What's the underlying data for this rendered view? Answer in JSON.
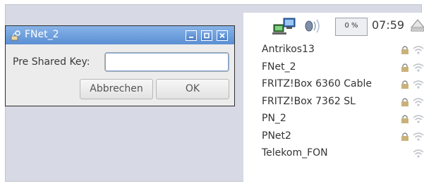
{
  "dialog": {
    "title": "FNet_2",
    "title_icon": "wifi-key-icon",
    "window_buttons": {
      "minimize": "minimize-icon",
      "maximize": "maximize-icon",
      "close": "close-icon"
    },
    "psk_label": "Pre Shared Key:",
    "psk_value": "",
    "cancel_label": "Abbrechen",
    "ok_label": "OK"
  },
  "tray": {
    "network_icon": "network-connections-icon",
    "volume_icon": "volume-icon",
    "cpu_usage": "0 %",
    "clock": "07:59",
    "eject_icon": "eject-icon"
  },
  "network_list": [
    {
      "ssid": "Antrikos13",
      "secured": true,
      "signal_icon": "wifi-signal-icon"
    },
    {
      "ssid": "FNet_2",
      "secured": true,
      "signal_icon": "wifi-signal-icon"
    },
    {
      "ssid": "FRITZ!Box 6360 Cable",
      "secured": true,
      "signal_icon": "wifi-signal-icon"
    },
    {
      "ssid": "FRITZ!Box 7362 SL",
      "secured": true,
      "signal_icon": "wifi-signal-icon"
    },
    {
      "ssid": "PN_2",
      "secured": true,
      "signal_icon": "wifi-signal-icon"
    },
    {
      "ssid": "PNet2",
      "secured": true,
      "signal_icon": "wifi-signal-icon"
    },
    {
      "ssid": "Telekom_FON",
      "secured": false,
      "signal_icon": "wifi-signal-icon"
    }
  ],
  "colors": {
    "desktop_background": "#d7d9e4",
    "titlebar": "#6b9de0",
    "dialog_background": "#ececec",
    "panel_background": "#ffffff"
  }
}
